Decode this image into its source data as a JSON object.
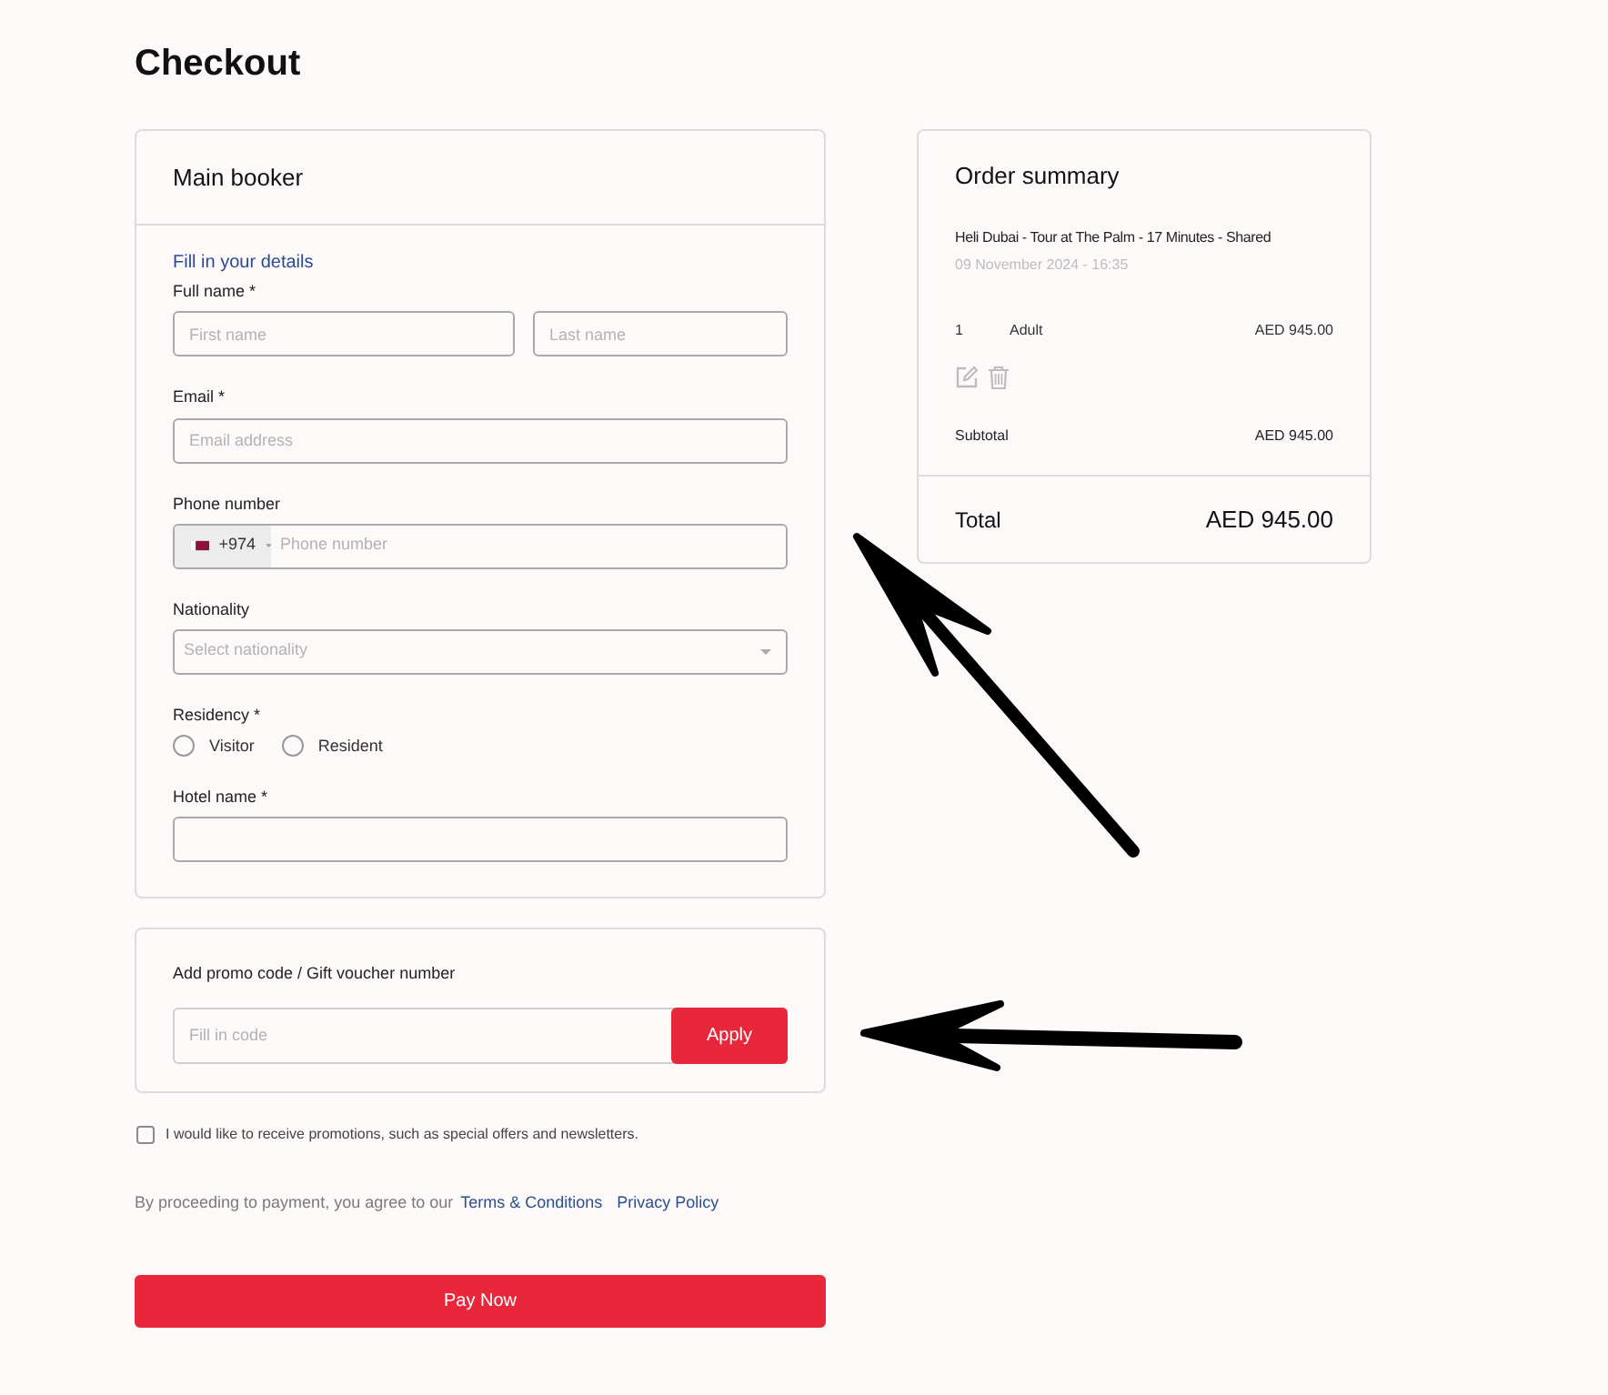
{
  "page": {
    "title": "Checkout"
  },
  "main_booker": {
    "title": "Main booker",
    "subtitle": "Fill in your details",
    "fields": [
      {
        "kind": "name",
        "label": "Full name *",
        "inputs": [
          {
            "placeholder": "First name"
          },
          {
            "placeholder": "Last name"
          }
        ]
      },
      {
        "kind": "text",
        "label": "Email *",
        "placeholder": "Email address"
      },
      {
        "kind": "phone",
        "label": "Phone number",
        "dial_code": "+974",
        "placeholder": "Phone number"
      },
      {
        "kind": "select",
        "label": "Nationality",
        "placeholder": "Select nationality"
      },
      {
        "kind": "radio",
        "label": "Residency *",
        "options": [
          {
            "label": "Visitor",
            "selected": false
          },
          {
            "label": "Resident",
            "selected": false
          }
        ]
      },
      {
        "kind": "text",
        "label": "Hotel name *"
      }
    ]
  },
  "order_summary": {
    "title": "Order summary",
    "item": {
      "name": "Heli Dubai - Tour at The Palm - 17 Minutes - Shared",
      "date": "09 November 2024 - 16:35"
    },
    "lines": [
      {
        "quantity": "1",
        "type": "Adult",
        "price": "AED 945.00"
      }
    ],
    "subtotal": {
      "label": "Subtotal",
      "value": "AED 945.00"
    },
    "total": {
      "label": "Total",
      "value": "AED 945.00"
    }
  },
  "promo": {
    "label": "Add promo code / Gift voucher number",
    "placeholder": "Fill in code",
    "button": "Apply"
  },
  "newsletter": {
    "label": "I would like to receive promotions, such as special offers and newsletters.",
    "checked": false
  },
  "legal": {
    "text": "By proceeding to payment, you agree to our",
    "links": [
      "Terms & Conditions",
      "Privacy Policy"
    ]
  },
  "pay_button": "Pay Now"
}
